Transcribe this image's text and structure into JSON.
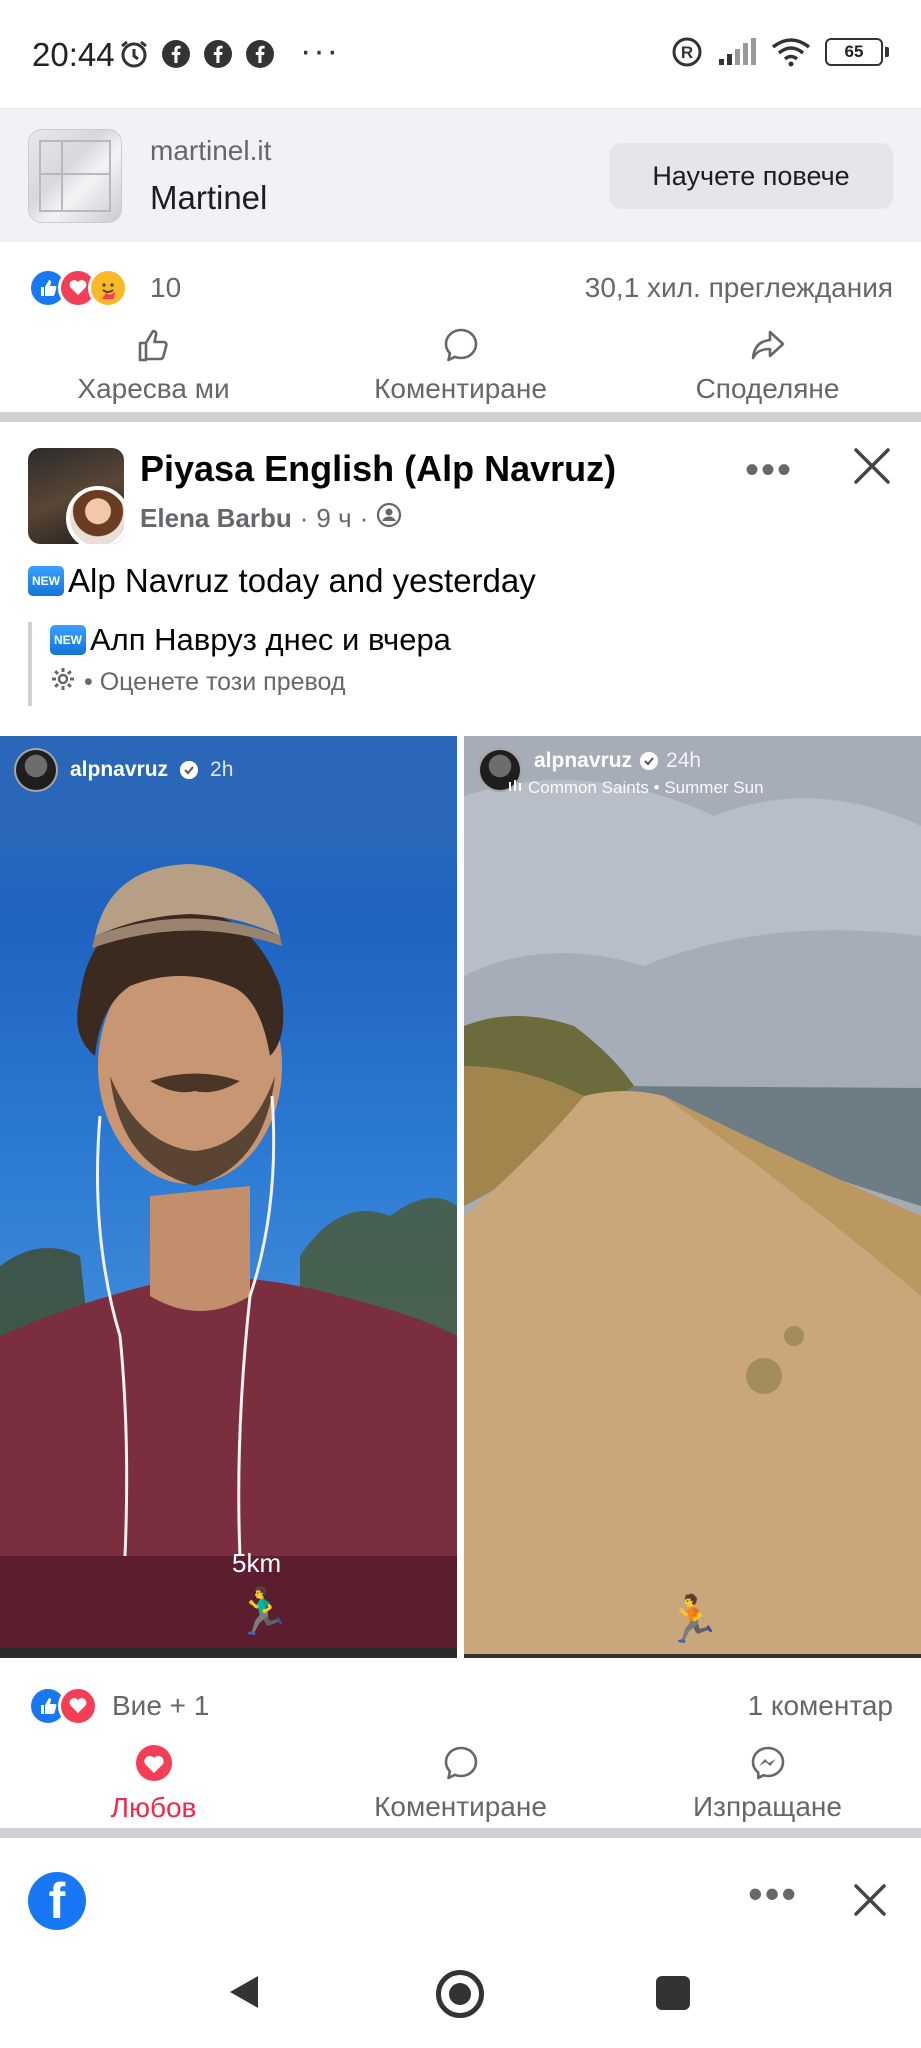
{
  "status_bar": {
    "time": "20:44",
    "more": "···",
    "battery": "65"
  },
  "ad": {
    "domain": "martinel.it",
    "name": "Martinel",
    "learn_more": "Научете повече"
  },
  "ad_reactions": {
    "count": "10",
    "views": "30,1 хил. преглеждания"
  },
  "ad_actions": {
    "like": "Харесва ми",
    "comment": "Коментиране",
    "share": "Споделяне"
  },
  "post": {
    "group": "Piyasa English (Alp Navruz)",
    "author": "Elena Barbu",
    "time": "9 ч",
    "separator": "·",
    "more": "•••",
    "new_badge": "NEW",
    "text": "Alp Navruz today and yesterday",
    "translation": "Алп Навруз днес и вчера",
    "rate_translation": "• Оценете този превод"
  },
  "photos": {
    "left": {
      "user": "alpnavruz",
      "time": "2h",
      "km": "5km",
      "runner": "🏃‍♂️"
    },
    "right": {
      "user": "alpnavruz",
      "time": "24h",
      "song": "Common Saints • Summer Sun",
      "runner": "🏃"
    }
  },
  "post_reactions": {
    "you": "Вие + 1",
    "comments": "1 коментар"
  },
  "post_actions": {
    "love": "Любов",
    "comment": "Коментиране",
    "send": "Изпращане"
  },
  "browser": {
    "logo": "f",
    "more": "•••"
  },
  "colors": {
    "facebook_blue": "#1877f2",
    "love_red": "#f02849"
  }
}
